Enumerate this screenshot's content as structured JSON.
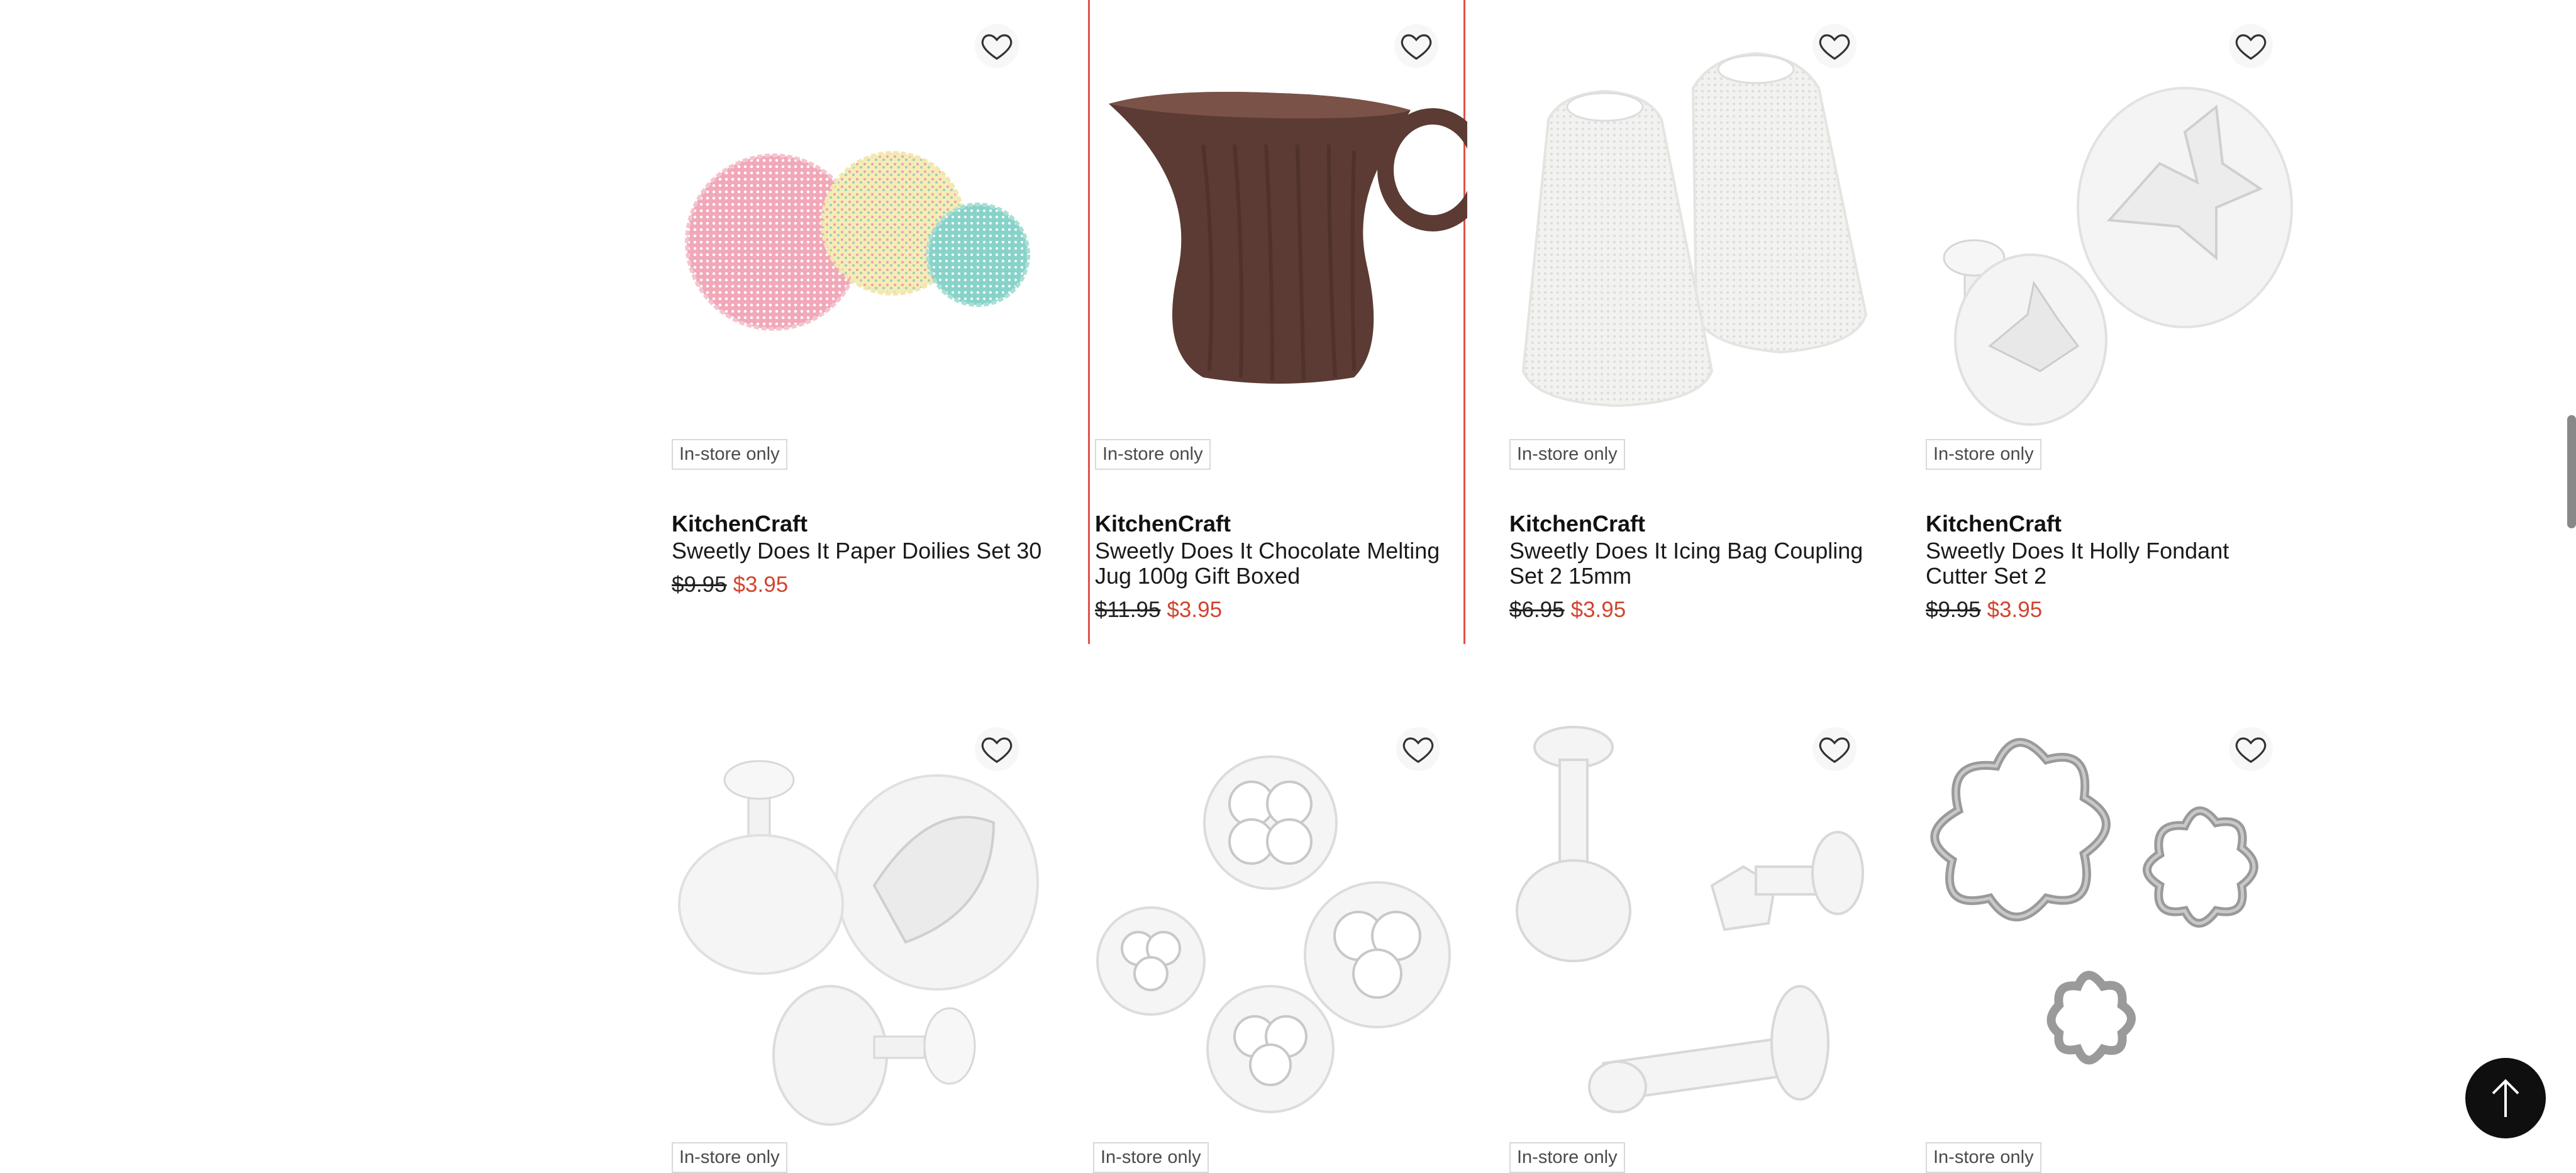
{
  "badge_text": "In-store only",
  "products": [
    {
      "brand": "KitchenCraft",
      "title": "Sweetly Does It Paper Doilies Set 30",
      "old_price": "$9.95",
      "new_price": "$3.95",
      "icon": "doilies-image"
    },
    {
      "brand": "KitchenCraft",
      "title": "Sweetly Does It Chocolate Melting Jug 100g Gift Boxed",
      "old_price": "$11.95",
      "new_price": "$3.95",
      "icon": "melting-jug-image"
    },
    {
      "brand": "KitchenCraft",
      "title": "Sweetly Does It Icing Bag Coupling Set 2 15mm",
      "old_price": "$6.95",
      "new_price": "$3.95",
      "icon": "coupling-set-image"
    },
    {
      "brand": "KitchenCraft",
      "title": "Sweetly Does It Holly Fondant Cutter Set 2",
      "old_price": "$9.95",
      "new_price": "$3.95",
      "icon": "holly-cutter-image"
    },
    {
      "icon": "leaf-cutter-image"
    },
    {
      "icon": "flower-cutter-image"
    },
    {
      "icon": "plunger-cutter-image"
    },
    {
      "icon": "metal-flower-cutter-image"
    }
  ],
  "colors": {
    "sale": "#d2442f",
    "highlight": "#e05246"
  }
}
